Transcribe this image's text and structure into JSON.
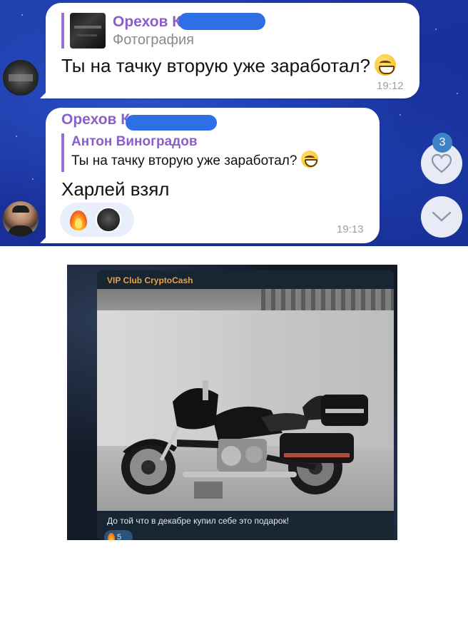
{
  "chat": {
    "message1": {
      "reply_sender": "Орехов К",
      "reply_type": "Фотография",
      "text": "Ты на тачку вторую уже заработал?",
      "time": "19:12"
    },
    "message2": {
      "sender": "Орехов К",
      "reply_sender": "Антон Виноградов",
      "reply_text": "Ты на тачку вторую уже заработал?",
      "text": "Харлей взял",
      "time": "19:13",
      "reactions": [
        "fire",
        "avatar"
      ]
    },
    "unread_badge": "3"
  },
  "post": {
    "channel_name": "VIP Club CryptoCash",
    "caption": "До той что в декабре купил себе это подарок!",
    "reaction_count": "5"
  },
  "colors": {
    "chat_bg": "#1f3fae",
    "sender_name": "#8b5fc9",
    "channel_name": "#e7a04a",
    "redaction": "#2f6fe6"
  }
}
